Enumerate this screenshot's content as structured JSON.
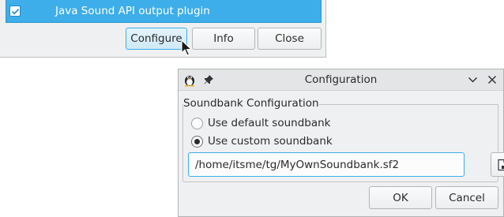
{
  "plugin_window": {
    "selected_plugin": {
      "label": "Java Sound API output plugin",
      "checked": true
    },
    "buttons": {
      "configure": "Configure",
      "info": "Info",
      "close": "Close"
    }
  },
  "config_dialog": {
    "title": "Configuration",
    "icons": {
      "app": "tux-icon",
      "pin": "pin-icon",
      "minimize": "chevron-down-icon",
      "close": "close-icon"
    },
    "group_title": "Soundbank Configuration",
    "options": [
      {
        "label": "Use default soundbank",
        "selected": false
      },
      {
        "label": "Use custom soundbank",
        "selected": true
      }
    ],
    "path_value": "/home/itsme/tg/MyOwnSoundbank.sf2",
    "browse_icon": "file-open-icon",
    "buttons": {
      "ok": "OK",
      "cancel": "Cancel"
    }
  },
  "colors": {
    "accent": "#3daee9",
    "window_bg": "#eff0f1",
    "text": "#2b2b2b"
  }
}
